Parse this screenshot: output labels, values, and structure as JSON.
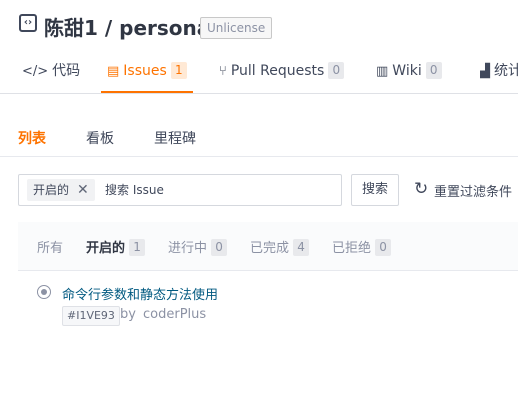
{
  "repo": {
    "icon": "code-icon",
    "owner": "陈甜1",
    "separator": " / ",
    "name": "personal",
    "license": "Unlicense"
  },
  "repo_tabs": [
    {
      "icon": "code-icon",
      "glyph": "</>",
      "label": "代码"
    },
    {
      "icon": "issues-icon",
      "glyph": "▤",
      "label": "Issues",
      "count": "1",
      "active": true
    },
    {
      "icon": "pull-request-icon",
      "glyph": "⑂",
      "label": "Pull Requests",
      "count": "0"
    },
    {
      "icon": "wiki-icon",
      "glyph": "▥",
      "label": "Wiki",
      "count": "0"
    },
    {
      "icon": "stats-icon",
      "glyph": "▟",
      "label": "统计"
    }
  ],
  "sub_tabs": [
    {
      "label": "列表",
      "active": true
    },
    {
      "label": "看板"
    },
    {
      "label": "里程碑"
    }
  ],
  "search": {
    "filter_tag": "开启的",
    "close_glyph": "✕",
    "placeholder": "搜索 Issue",
    "value": "",
    "button": "搜索",
    "reset_glyph": "↻",
    "reset_label": "重置过滤条件"
  },
  "states": [
    {
      "label": "所有"
    },
    {
      "label": "开启的",
      "count": "1",
      "active": true
    },
    {
      "label": "进行中",
      "count": "0"
    },
    {
      "label": "已完成",
      "count": "4"
    },
    {
      "label": "已拒绝",
      "count": "0"
    }
  ],
  "issues": [
    {
      "title": "命令行参数和静态方法使用",
      "id": "#I1VE93",
      "by": "by",
      "author": "coderPlus"
    }
  ],
  "colors": {
    "accent": "#fe7300",
    "link": "#005980",
    "text": "#40485b",
    "muted": "#8c92a4"
  }
}
